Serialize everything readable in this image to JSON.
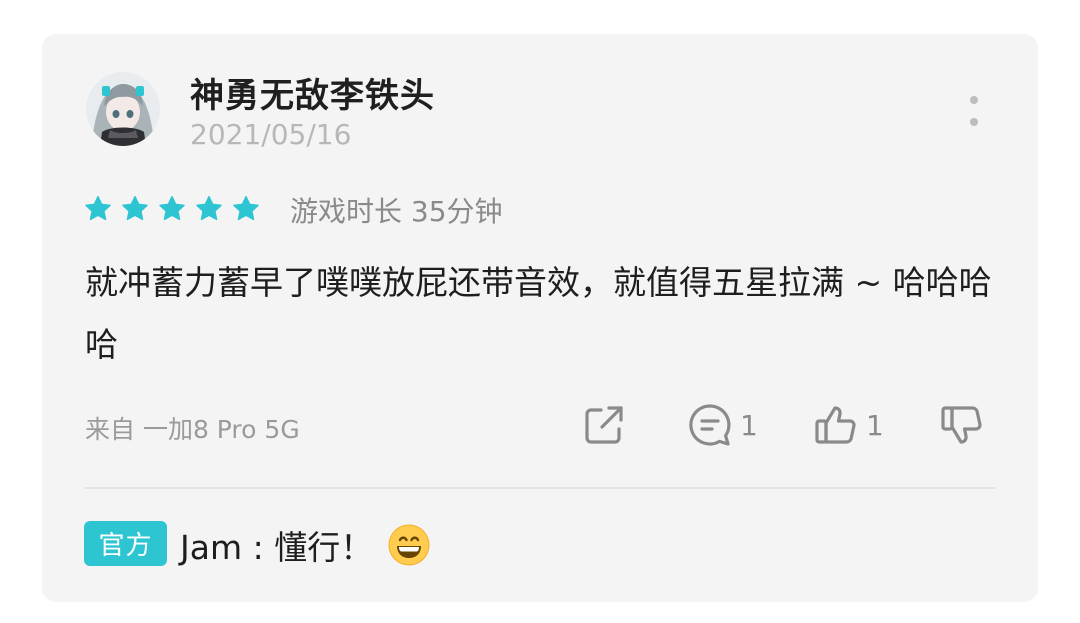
{
  "review": {
    "username": "神勇无敌李铁头",
    "date": "2021/05/16",
    "rating": 5,
    "rating_max": 5,
    "playtime": "游戏时长 35分钟",
    "text": "就冲蓄力蓄早了噗噗放屁还带音效，就值得五星拉满 ~ 哈哈哈哈",
    "device": "来自 一加8 Pro 5G"
  },
  "actions": {
    "share_icon": "share-icon",
    "comment_icon": "comment-icon",
    "comment_count": "1",
    "like_icon": "thumbs-up-icon",
    "like_count": "1",
    "dislike_icon": "thumbs-down-icon"
  },
  "official_reply": {
    "badge": "官方",
    "text": "Jam : 懂行！",
    "emoji": "grinning-face-emoji"
  },
  "colors": {
    "accent": "#2ec5d3",
    "card_bg": "#f4f4f5",
    "muted_text": "#9a9a9a"
  }
}
